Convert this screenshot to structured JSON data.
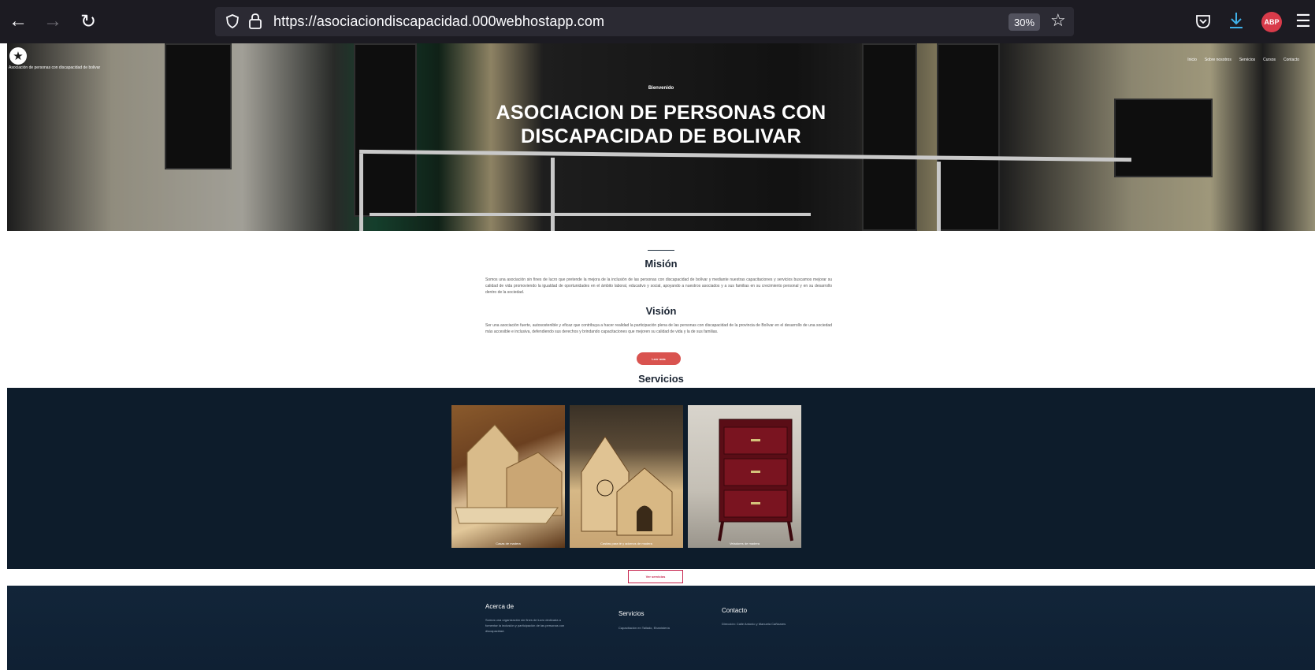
{
  "browser": {
    "url": "https://asociaciondiscapacidad.000webhostapp.com",
    "zoom": "30%",
    "addon_badge": "ABP",
    "icons": [
      "back-arrow-icon",
      "forward-arrow-icon",
      "reload-icon",
      "shield-icon",
      "lock-icon",
      "star-icon",
      "pocket-icon",
      "download-icon",
      "adblock-icon",
      "menu-icon"
    ]
  },
  "hero": {
    "brand": "Asociación de personas con discapacidad de bolivar",
    "nav": [
      "Inicio",
      "Sobre nosotros",
      "Servicios",
      "Cursos",
      "Contacto"
    ],
    "kicker": "Bienvenido",
    "title": "ASOCIACION DE PERSONAS CON DISCAPACIDAD DE BOLIVAR"
  },
  "mission": {
    "heading": "Misión",
    "body": "Somos una asociación sin fines de lucro que pretende la mejora de la inclusión de las personas con discapacidad de bolívar y mediante nuestras capacitaciones y servicios buscamos mejorar su calidad de vida promoviendo la igualdad de oportunidades en el ámbito laboral, educativo y social, apoyando a nuestros asociados y a sus familias en su crecimiento personal y en su desarrollo dentro de la sociedad."
  },
  "vision": {
    "heading": "Visión",
    "body": "Ser una asociación fuerte, autosostenible y eficaz que contribuya a hacer realidad la participación plena de las personas con discapacidad de la provincia de Bolívar en el desarrollo de una sociedad más accesible e inclusiva, defendiendo sus derechos y brindando capacitaciones que mejoren su calidad de vida y la de sus familias."
  },
  "cta_button": "Leer más",
  "services": {
    "heading": "Servicios",
    "items": [
      {
        "caption": "Casas de madera"
      },
      {
        "caption": "Casitas para té y adornos de madera"
      },
      {
        "caption": "Veladores de madera"
      }
    ],
    "more_button": "Ver servicios"
  },
  "footer": {
    "about_heading": "Acerca de",
    "about_text": "Somos una organización sin fines de lucro dedicada a fomentar la inclusión y participación de las personas con discapacidad.",
    "services_heading": "Servicios",
    "services_text": "Capacitación en Tallado, Ebanistería",
    "contact_heading": "Contacto",
    "contact_text": "Dirección: Calle Antonio y Manuela Cañizares"
  }
}
